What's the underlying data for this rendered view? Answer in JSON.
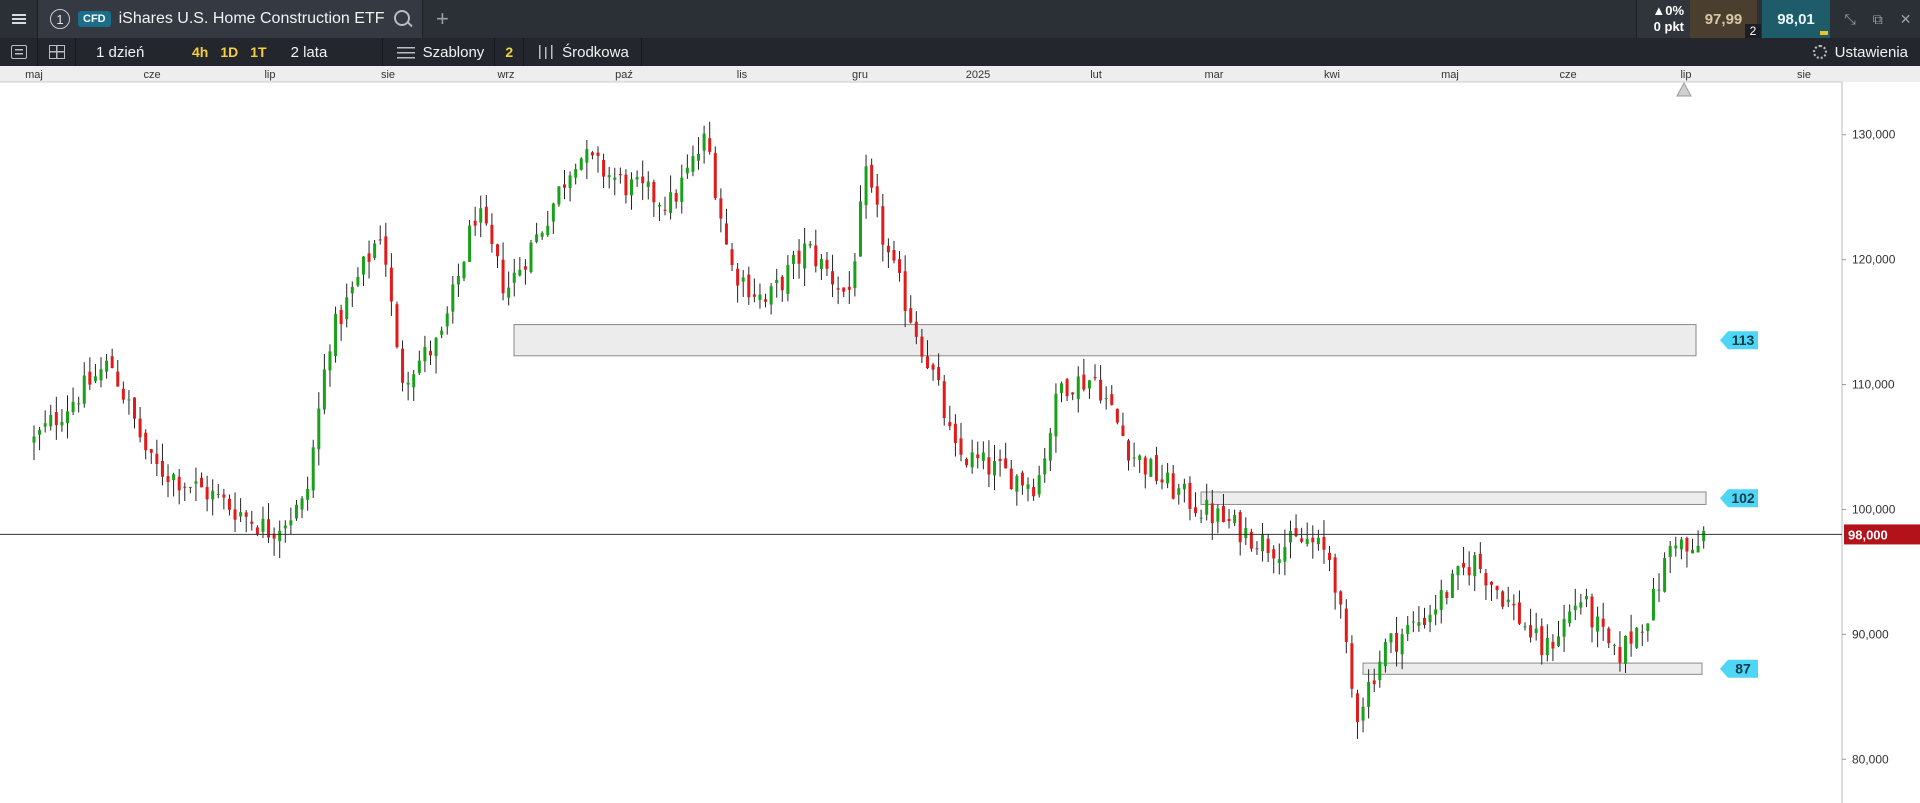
{
  "window": {
    "tab_number": "1",
    "instrument_type": "CFD",
    "instrument_name": "iShares U.S. Home Construction ETF",
    "add_tab": "+"
  },
  "quote": {
    "change_pct": "▲0%",
    "change_pts": "0 pkt",
    "sell": "97,99",
    "buy": "98,01",
    "spread": "2"
  },
  "toolbar": {
    "timeframe": "1 dzień",
    "quick_timeframes": [
      "4h",
      "1D",
      "1T"
    ],
    "range": "2 lata",
    "templates_label": "Szablony",
    "templates_count": "2",
    "chart_type": "Środkowa",
    "settings_label": "Ustawienia"
  },
  "chart_data": {
    "type": "candlestick",
    "x_ticks": [
      "maj",
      "cze",
      "lip",
      "sie",
      "wrz",
      "paź",
      "lis",
      "gru",
      "2025",
      "lut",
      "mar",
      "kwi",
      "maj",
      "cze",
      "lip",
      "sie"
    ],
    "y_ticks": [
      "80,000",
      "90,000",
      "100,000",
      "110,000",
      "120,000",
      "130,000"
    ],
    "ylim": [
      76.5,
      135.5
    ],
    "current_price": 98.0,
    "current_price_label": "98,000",
    "up_color": "#1aa11a",
    "down_color": "#e01b1b",
    "zones": [
      {
        "label": "113",
        "low": 112.3,
        "high": 114.8
      },
      {
        "label": "102",
        "low": 100.4,
        "high": 101.4
      },
      {
        "label": "87",
        "low": 86.8,
        "high": 87.7
      }
    ],
    "anchors": [
      {
        "m": 0.0,
        "p": 105.5
      },
      {
        "m": 0.3,
        "p": 108.5
      },
      {
        "m": 0.65,
        "p": 111.8
      },
      {
        "m": 1.0,
        "p": 103.5
      },
      {
        "m": 1.5,
        "p": 101.2
      },
      {
        "m": 2.0,
        "p": 98.3
      },
      {
        "m": 2.3,
        "p": 100.5
      },
      {
        "m": 2.5,
        "p": 113.5
      },
      {
        "m": 2.95,
        "p": 122.5
      },
      {
        "m": 3.1,
        "p": 110.5
      },
      {
        "m": 3.45,
        "p": 113.5
      },
      {
        "m": 3.75,
        "p": 124.0
      },
      {
        "m": 4.0,
        "p": 117.5
      },
      {
        "m": 4.3,
        "p": 122.5
      },
      {
        "m": 4.6,
        "p": 128.5
      },
      {
        "m": 5.0,
        "p": 126.0
      },
      {
        "m": 5.4,
        "p": 124.5
      },
      {
        "m": 5.7,
        "p": 129.8
      },
      {
        "m": 5.9,
        "p": 119.5
      },
      {
        "m": 6.2,
        "p": 116.5
      },
      {
        "m": 6.55,
        "p": 121.0
      },
      {
        "m": 6.9,
        "p": 117.0
      },
      {
        "m": 7.05,
        "p": 126.5
      },
      {
        "m": 7.25,
        "p": 120.0
      },
      {
        "m": 7.45,
        "p": 115.0
      },
      {
        "m": 7.65,
        "p": 110.0
      },
      {
        "m": 7.8,
        "p": 104.5
      },
      {
        "m": 8.2,
        "p": 103.0
      },
      {
        "m": 8.5,
        "p": 102.0
      },
      {
        "m": 8.7,
        "p": 110.0
      },
      {
        "m": 9.0,
        "p": 110.5
      },
      {
        "m": 9.3,
        "p": 104.5
      },
      {
        "m": 9.6,
        "p": 102.0
      },
      {
        "m": 9.9,
        "p": 100.0
      },
      {
        "m": 10.2,
        "p": 98.5
      },
      {
        "m": 10.5,
        "p": 97.0
      },
      {
        "m": 10.8,
        "p": 97.5
      },
      {
        "m": 11.0,
        "p": 96.0
      },
      {
        "m": 11.2,
        "p": 83.5
      },
      {
        "m": 11.45,
        "p": 89.0
      },
      {
        "m": 11.8,
        "p": 91.5
      },
      {
        "m": 12.2,
        "p": 96.0
      },
      {
        "m": 12.5,
        "p": 92.5
      },
      {
        "m": 12.8,
        "p": 88.5
      },
      {
        "m": 13.1,
        "p": 93.0
      },
      {
        "m": 13.4,
        "p": 88.0
      },
      {
        "m": 13.7,
        "p": 92.0
      },
      {
        "m": 13.9,
        "p": 98.0
      },
      {
        "m": 14.05,
        "p": 96.0
      },
      {
        "m": 14.15,
        "p": 98.0
      }
    ]
  }
}
